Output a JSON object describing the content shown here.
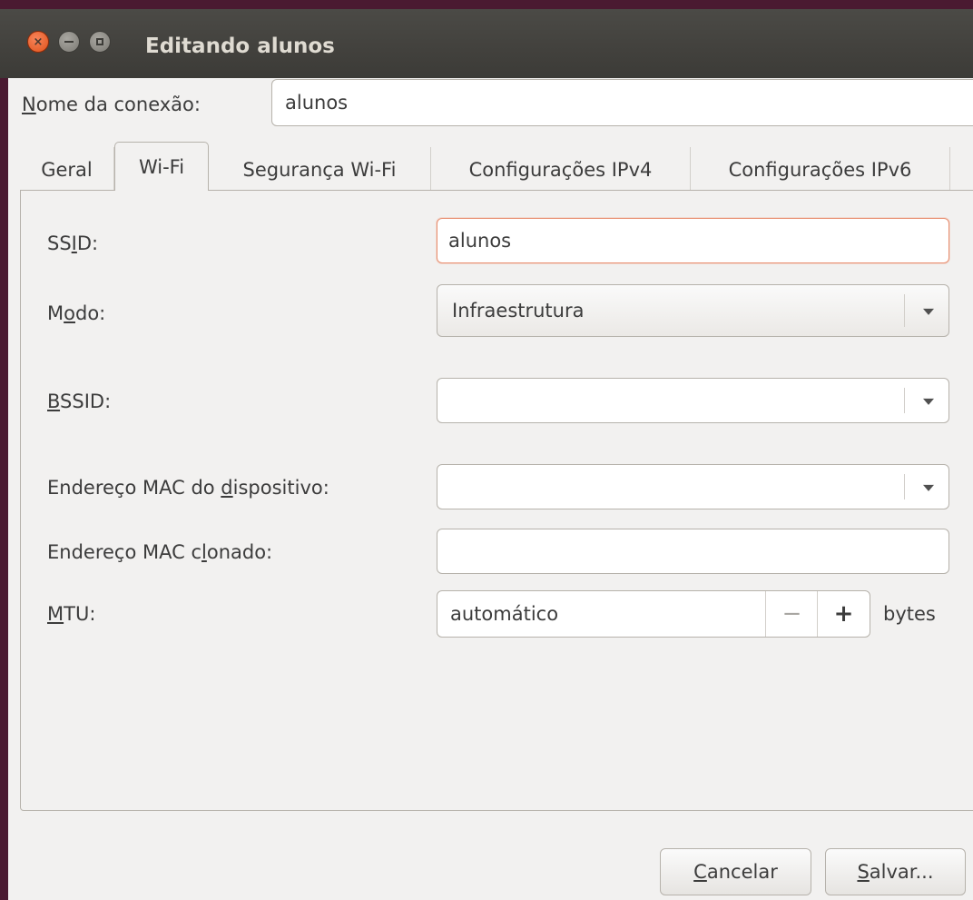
{
  "window": {
    "title": "Editando alunos"
  },
  "connection": {
    "label_u": "N",
    "label_rest": "ome da conexão:",
    "value": "alunos"
  },
  "tabs": [
    {
      "label": "Geral",
      "active": false
    },
    {
      "label": "Wi-Fi",
      "active": true
    },
    {
      "label": "Segurança Wi-Fi",
      "active": false
    },
    {
      "label": "Configurações IPv4",
      "active": false
    },
    {
      "label": "Configurações IPv6",
      "active": false
    }
  ],
  "wifi": {
    "ssid": {
      "label_a": "SS",
      "label_u": "I",
      "label_b": "D:",
      "value": "alunos"
    },
    "mode": {
      "label_a": "M",
      "label_u": "o",
      "label_b": "do:",
      "value": "Infraestrutura"
    },
    "bssid": {
      "label_u": "B",
      "label_b": "SSID:",
      "value": ""
    },
    "mac": {
      "label_a": "Endereço MAC do ",
      "label_u": "d",
      "label_b": "ispositivo:",
      "value": ""
    },
    "cloned_mac": {
      "label_a": "Endereço MAC c",
      "label_u": "l",
      "label_b": "onado:",
      "value": ""
    },
    "mtu": {
      "label_u": "M",
      "label_b": "TU:",
      "value": "automático",
      "minus": "−",
      "plus": "+",
      "unit": "bytes"
    }
  },
  "buttons": {
    "cancel_u": "C",
    "cancel_rest": "ancelar",
    "save_u": "S",
    "save_rest": "alvar..."
  }
}
